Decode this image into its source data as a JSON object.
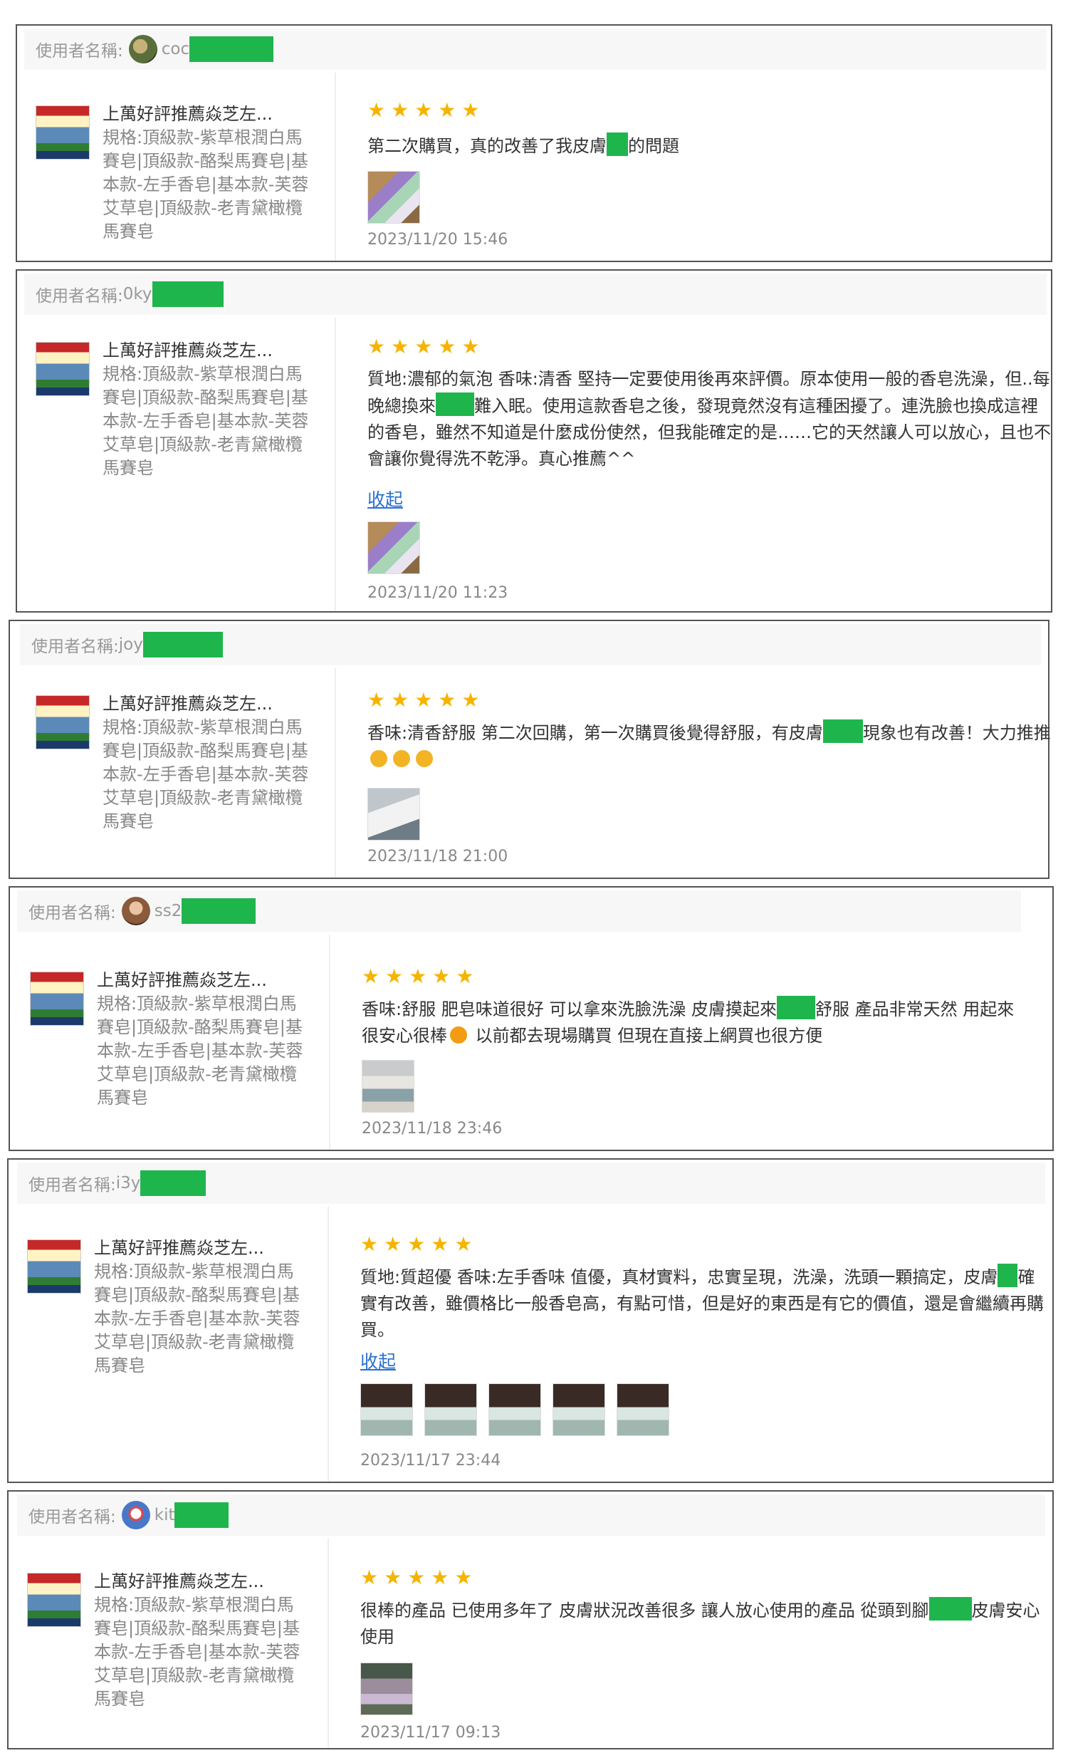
{
  "labels": {
    "username_prefix": "使用者名稱:",
    "collapse": "收起"
  },
  "product": {
    "title": "上萬好評推薦焱芝左...",
    "spec": "規格:頂級款-紫草根潤白馬賽皂|頂級款-酪梨馬賽皂|基本款-左手香皂|基本款-芙蓉艾草皂|頂級款-老青黛橄欖馬賽皂"
  },
  "reviews": [
    {
      "username": "coc",
      "stars": "★★★★★",
      "text_parts": [
        "第二次購買，真的改善了我皮膚",
        "的問題"
      ],
      "date": "2023/11/20 15:46"
    },
    {
      "username": "0ky",
      "stars": "★★★★★",
      "text_parts": [
        "質地:濃郁的氣泡 香味:清香 堅持一定要使用後再來評價。原本使用一般的香皂洗澡，但..每晚總換來",
        "難入眠。使用這款香皂之後，發現竟然沒有這種困擾了。連洗臉也換成這裡的香皂，雖然不知道是什麼成份使然，但我能確定的是……它的天然讓人可以放心，且也不會讓你覺得洗不乾淨。真心推薦^^"
      ],
      "date": "2023/11/20 11:23"
    },
    {
      "username": "joy",
      "stars": "★★★★★",
      "text_parts": [
        "香味:清香舒服 第二次回購，第一次購買後覺得舒服，有皮膚",
        "現象也有改善！大力推推"
      ],
      "date": "2023/11/18 21:00"
    },
    {
      "username": "ss2",
      "stars": "★★★★★",
      "text_parts": [
        "香味:舒服 肥皂味道很好 可以拿來洗臉洗澡 皮膚摸起來",
        "舒服 產品非常天然 用起來很安心很棒",
        " 以前都去現場購買 但現在直接上網買也很方便"
      ],
      "date": "2023/11/18 23:46"
    },
    {
      "username": "i3y",
      "stars": "★★★★★",
      "text_parts": [
        "質地:質超優 香味:左手香味 值優，真材實料，忠實呈現，洗澡，洗頭一顆搞定，皮膚",
        "確實有改善，雖價格比一般香皂高，有點可惜，但是好的東西是有它的價值，還是會繼續再購買。"
      ],
      "date": "2023/11/17 23:44"
    },
    {
      "username": "kit",
      "stars": "★★★★★",
      "text_parts": [
        "很棒的產品 已使用多年了 皮膚狀況改善很多 讓人放心使用的產品 從頭到腳",
        "皮膚安心使用"
      ],
      "date": "2023/11/17 09:13"
    }
  ],
  "colors": {
    "star": "#f5b400",
    "link": "#2a6fcf",
    "redaction": "#1fb54d"
  }
}
